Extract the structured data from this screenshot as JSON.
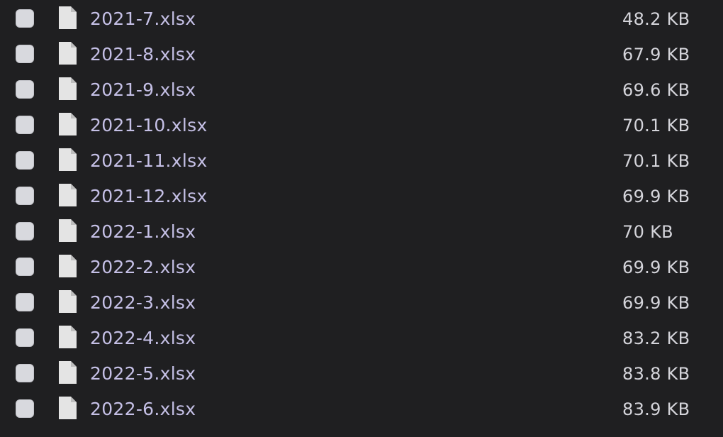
{
  "files": [
    {
      "name": "2021-7.xlsx",
      "size": "48.2 KB",
      "icon": "file-icon"
    },
    {
      "name": "2021-8.xlsx",
      "size": "67.9 KB",
      "icon": "file-icon"
    },
    {
      "name": "2021-9.xlsx",
      "size": "69.6 KB",
      "icon": "file-icon"
    },
    {
      "name": "2021-10.xlsx",
      "size": "70.1 KB",
      "icon": "file-icon"
    },
    {
      "name": "2021-11.xlsx",
      "size": "70.1 KB",
      "icon": "file-icon"
    },
    {
      "name": "2021-12.xlsx",
      "size": "69.9 KB",
      "icon": "file-icon"
    },
    {
      "name": "2022-1.xlsx",
      "size": "70 KB",
      "icon": "file-icon"
    },
    {
      "name": "2022-2.xlsx",
      "size": "69.9 KB",
      "icon": "file-icon"
    },
    {
      "name": "2022-3.xlsx",
      "size": "69.9 KB",
      "icon": "file-icon"
    },
    {
      "name": "2022-4.xlsx",
      "size": "83.2 KB",
      "icon": "file-icon"
    },
    {
      "name": "2022-5.xlsx",
      "size": "83.8 KB",
      "icon": "file-icon"
    },
    {
      "name": "2022-6.xlsx",
      "size": "83.9 KB",
      "icon": "file-icon"
    }
  ],
  "colors": {
    "background": "#1f1f21",
    "filename": "#c5c0e6",
    "size_text": "#d4d4da",
    "checkbox": "#d8d9de",
    "file_icon": "#e4e4e4"
  }
}
